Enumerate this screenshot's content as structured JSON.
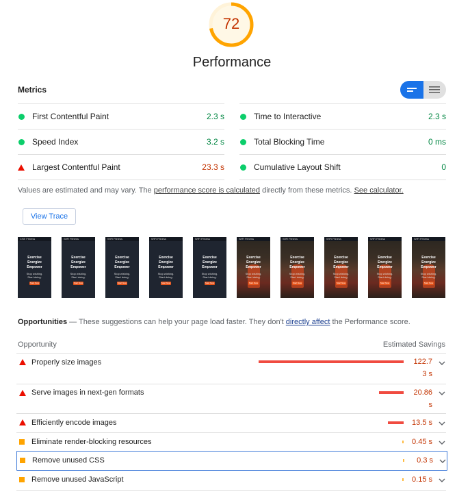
{
  "gauge": {
    "score": "72",
    "label": "Performance",
    "fraction": 0.72,
    "color": "#ffa400"
  },
  "metrics": {
    "label": "Metrics",
    "items": [
      {
        "name": "First Contentful Paint",
        "value": "2.3 s",
        "status": "pass"
      },
      {
        "name": "Time to Interactive",
        "value": "2.3 s",
        "status": "pass"
      },
      {
        "name": "Speed Index",
        "value": "3.2 s",
        "status": "pass"
      },
      {
        "name": "Total Blocking Time",
        "value": "0 ms",
        "status": "pass"
      },
      {
        "name": "Largest Contentful Paint",
        "value": "23.3 s",
        "status": "fail"
      },
      {
        "name": "Cumulative Layout Shift",
        "value": "0",
        "status": "pass"
      }
    ]
  },
  "disclaimer": {
    "prefix": "Values are estimated and may vary. The ",
    "link1": "performance score is calculated",
    "middle": " directly from these metrics. ",
    "link2": "See calculator."
  },
  "view_trace_label": "View Trace",
  "filmstrip": [
    {
      "bar": "CSE Fitness",
      "l1": "Exercise",
      "l2": "Energize",
      "l3": "Empower",
      "s1": "Stop wishing.",
      "s2": "Start doing.",
      "btn": "Start Now",
      "photo": false
    },
    {
      "bar": "WiFi Fitness",
      "l1": "Exercise",
      "l2": "Energize",
      "l3": "Empower",
      "s1": "Stop wishing.",
      "s2": "Start doing.",
      "btn": "Start Now",
      "photo": false
    },
    {
      "bar": "WiFi Fitness",
      "l1": "Exercise",
      "l2": "Energize",
      "l3": "Empower",
      "s1": "Stop wishing.",
      "s2": "Start doing.",
      "btn": "Start Now",
      "photo": false
    },
    {
      "bar": "WiFi Fitness",
      "l1": "Exercise",
      "l2": "Energize",
      "l3": "Empower",
      "s1": "Stop wishing.",
      "s2": "Start doing.",
      "btn": "Start Now",
      "photo": false
    },
    {
      "bar": "WiFi Fitness",
      "l1": "Exercise",
      "l2": "Energize",
      "l3": "Empower",
      "s1": "Stop wishing.",
      "s2": "Start doing.",
      "btn": "Start Now",
      "photo": false
    },
    {
      "bar": "WiFi Fitness",
      "l1": "Exercise",
      "l2": "Energize",
      "l3": "Empower",
      "s1": "Stop wishing.",
      "s2": "Start doing.",
      "btn": "Start Now",
      "photo": true
    },
    {
      "bar": "WiFi Fitness",
      "l1": "Exercise",
      "l2": "Energize",
      "l3": "Empower",
      "s1": "Stop wishing.",
      "s2": "Start doing.",
      "btn": "Start Now",
      "photo": true
    },
    {
      "bar": "WiFi Fitness",
      "l1": "Exercise",
      "l2": "Energize",
      "l3": "Empower",
      "s1": "Stop wishing.",
      "s2": "Start doing.",
      "btn": "Start Now",
      "photo": true
    },
    {
      "bar": "WiFi Fitness",
      "l1": "Exercise",
      "l2": "Energize",
      "l3": "Empower",
      "s1": "Stop wishing.",
      "s2": "Start doing.",
      "btn": "Start Now",
      "photo": true
    },
    {
      "bar": "WiFi Fitness",
      "l1": "Exercise",
      "l2": "Energize",
      "l3": "Empower",
      "s1": "Stop wishing.",
      "s2": "Start doing.",
      "btn": "Start Now",
      "photo": true
    }
  ],
  "opportunities": {
    "heading": "Opportunities",
    "sub_prefix": " — These suggestions can help your page load faster. They don't ",
    "sub_link": "directly affect",
    "sub_suffix": " the Performance score.",
    "col_opportunity": "Opportunity",
    "col_savings": "Estimated Savings",
    "items": [
      {
        "title": "Properly size images",
        "savings_line1": "122.7",
        "savings_line2": "3 s",
        "bar_fraction": 1.0,
        "severity": "fail"
      },
      {
        "title": "Serve images in next-gen formats",
        "savings_line1": "20.86",
        "savings_line2": "s",
        "bar_fraction": 0.17,
        "severity": "fail"
      },
      {
        "title": "Efficiently encode images",
        "savings_line1": "13.5 s",
        "savings_line2": "",
        "bar_fraction": 0.11,
        "severity": "fail"
      },
      {
        "title": "Eliminate render-blocking resources",
        "savings_line1": "0.45 s",
        "savings_line2": "",
        "bar_fraction": 0.004,
        "severity": "average"
      },
      {
        "title": "Remove unused CSS",
        "savings_line1": "0.3 s",
        "savings_line2": "",
        "bar_fraction": 0.003,
        "severity": "average"
      },
      {
        "title": "Remove unused JavaScript",
        "savings_line1": "0.15 s",
        "savings_line2": "",
        "bar_fraction": 0.0015,
        "severity": "average"
      }
    ]
  }
}
